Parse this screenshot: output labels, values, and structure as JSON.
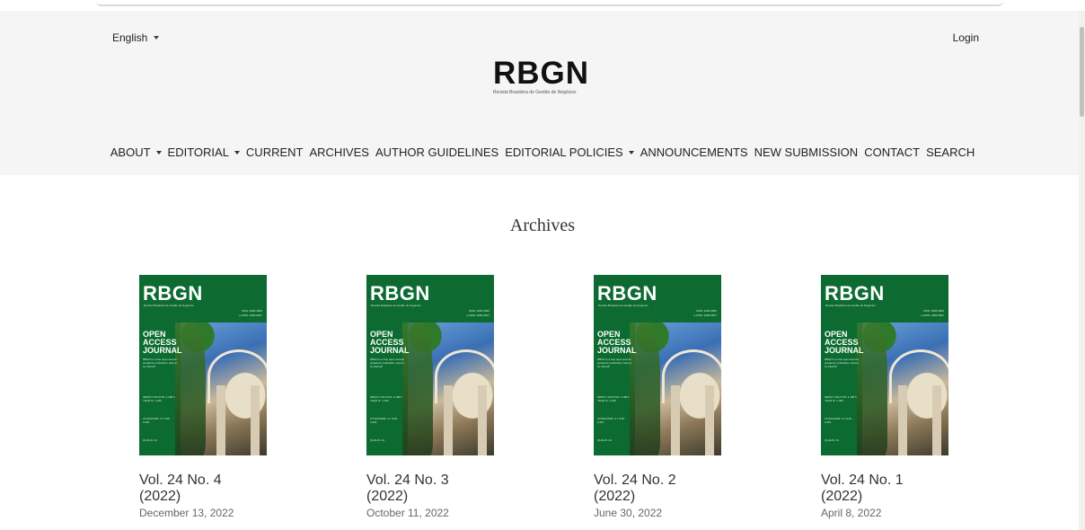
{
  "header": {
    "language": "English",
    "login": "Login",
    "logo_title": "RBGN",
    "logo_subtitle": "Revista Brasileira de Gestão de Negócios"
  },
  "nav": [
    {
      "label": "ABOUT",
      "dropdown": true
    },
    {
      "label": "EDITORIAL",
      "dropdown": true
    },
    {
      "label": "CURRENT",
      "dropdown": false
    },
    {
      "label": "ARCHIVES",
      "dropdown": false
    },
    {
      "label": "AUTHOR GUIDELINES",
      "dropdown": false
    },
    {
      "label": "EDITORIAL POLICIES",
      "dropdown": true
    },
    {
      "label": "ANNOUNCEMENTS",
      "dropdown": false
    },
    {
      "label": "NEW SUBMISSION",
      "dropdown": false
    },
    {
      "label": "CONTACT",
      "dropdown": false
    },
    {
      "label": "SEARCH",
      "dropdown": false
    }
  ],
  "page_title": "Archives",
  "cover": {
    "title": "RBGN",
    "subtitle": "Revista Brasileira de Gestão de Negócios",
    "issn_print": "ISSN: 1806-4892",
    "issn_online": "e-ISSN: 1983-0807",
    "open_access": "OPEN ACCESS JOURNAL",
    "publisher_note": "RBGN is a free open access academic publication issued by FECAP",
    "impact": "IMPACT FACTOR: 1.188 5 YEAR IF: 1.406",
    "citescore": "CITESCORE: 3.7 SJR: 0.361",
    "qualis": "QUALIS: A1",
    "color": "#0d6b32"
  },
  "issues": [
    {
      "volume": "Vol. 24 No. 4",
      "year": "(2022)",
      "date": "December 13, 2022"
    },
    {
      "volume": "Vol. 24 No. 3",
      "year": "(2022)",
      "date": "October 11, 2022"
    },
    {
      "volume": "Vol. 24 No. 2",
      "year": "(2022)",
      "date": "June 30, 2022"
    },
    {
      "volume": "Vol. 24 No. 1",
      "year": "(2022)",
      "date": "April 8, 2022"
    }
  ]
}
